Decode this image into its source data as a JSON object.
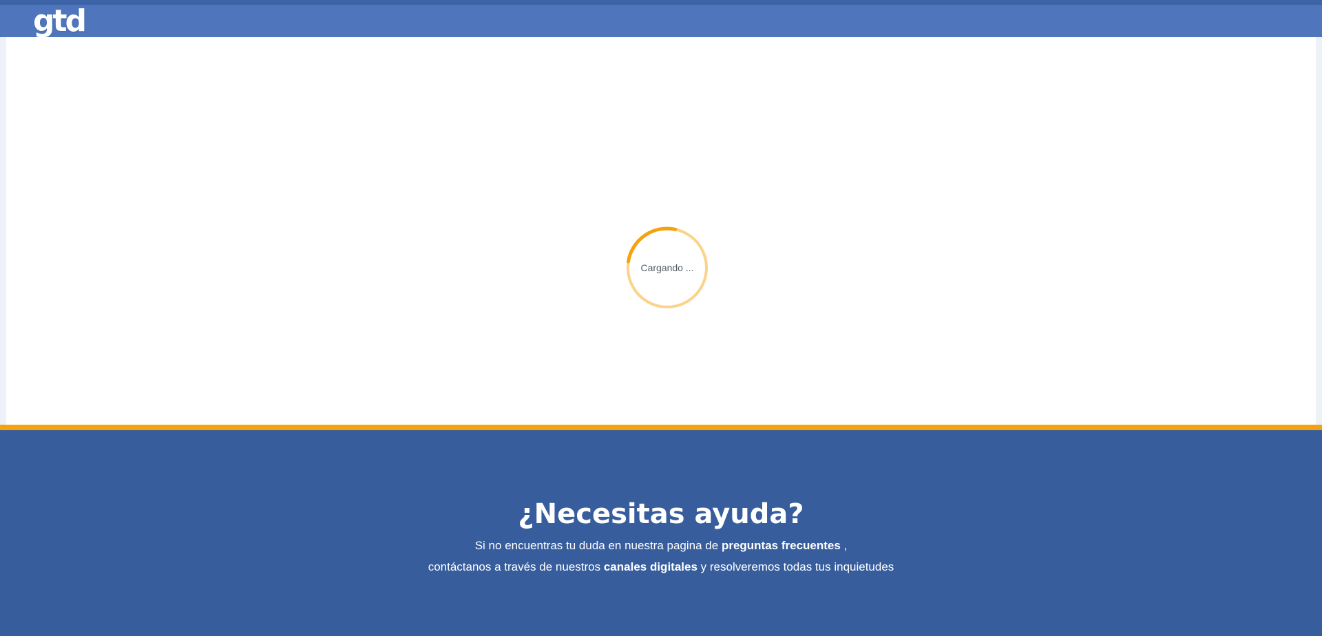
{
  "header": {
    "logo_text": "gtd"
  },
  "loader": {
    "text": "Cargando ..."
  },
  "footer": {
    "title": "¿Necesitas ayuda?",
    "line1_prefix": "Si no encuentras tu duda en nuestra pagina de ",
    "line1_link": "preguntas frecuentes",
    "line1_suffix": " ,",
    "line2_prefix": "contáctanos a través de nuestros ",
    "line2_link": "canales digitales",
    "line2_suffix": " y resolveremos todas tus inquietudes"
  },
  "colors": {
    "header_bg": "#4f76bc",
    "header_top_strip": "#3e64a8",
    "footer_bg": "#375d9c",
    "accent_orange": "#f6a20e",
    "spinner_track": "#fbd38a",
    "spinner_arc": "#f6a20e"
  }
}
